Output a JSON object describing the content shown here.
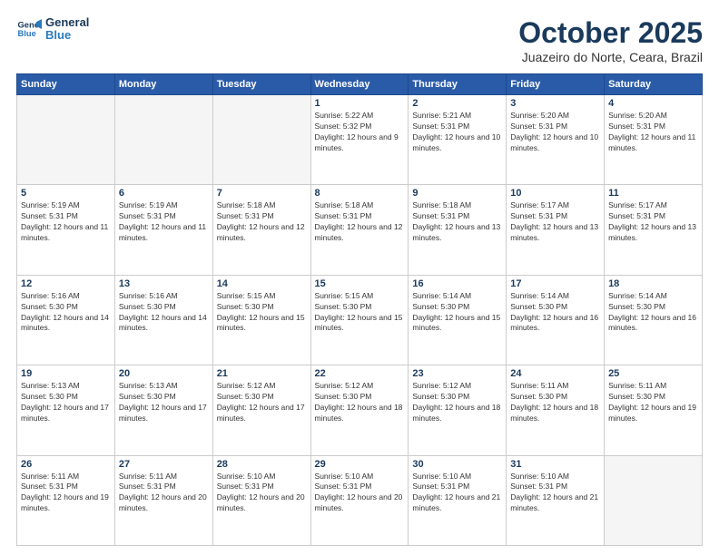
{
  "logo": {
    "line1": "General",
    "line2": "Blue"
  },
  "header": {
    "month": "October 2025",
    "location": "Juazeiro do Norte, Ceara, Brazil"
  },
  "days_of_week": [
    "Sunday",
    "Monday",
    "Tuesday",
    "Wednesday",
    "Thursday",
    "Friday",
    "Saturday"
  ],
  "weeks": [
    [
      {
        "day": "",
        "info": ""
      },
      {
        "day": "",
        "info": ""
      },
      {
        "day": "",
        "info": ""
      },
      {
        "day": "1",
        "info": "Sunrise: 5:22 AM\nSunset: 5:32 PM\nDaylight: 12 hours and 9 minutes."
      },
      {
        "day": "2",
        "info": "Sunrise: 5:21 AM\nSunset: 5:31 PM\nDaylight: 12 hours and 10 minutes."
      },
      {
        "day": "3",
        "info": "Sunrise: 5:20 AM\nSunset: 5:31 PM\nDaylight: 12 hours and 10 minutes."
      },
      {
        "day": "4",
        "info": "Sunrise: 5:20 AM\nSunset: 5:31 PM\nDaylight: 12 hours and 11 minutes."
      }
    ],
    [
      {
        "day": "5",
        "info": "Sunrise: 5:19 AM\nSunset: 5:31 PM\nDaylight: 12 hours and 11 minutes."
      },
      {
        "day": "6",
        "info": "Sunrise: 5:19 AM\nSunset: 5:31 PM\nDaylight: 12 hours and 11 minutes."
      },
      {
        "day": "7",
        "info": "Sunrise: 5:18 AM\nSunset: 5:31 PM\nDaylight: 12 hours and 12 minutes."
      },
      {
        "day": "8",
        "info": "Sunrise: 5:18 AM\nSunset: 5:31 PM\nDaylight: 12 hours and 12 minutes."
      },
      {
        "day": "9",
        "info": "Sunrise: 5:18 AM\nSunset: 5:31 PM\nDaylight: 12 hours and 13 minutes."
      },
      {
        "day": "10",
        "info": "Sunrise: 5:17 AM\nSunset: 5:31 PM\nDaylight: 12 hours and 13 minutes."
      },
      {
        "day": "11",
        "info": "Sunrise: 5:17 AM\nSunset: 5:31 PM\nDaylight: 12 hours and 13 minutes."
      }
    ],
    [
      {
        "day": "12",
        "info": "Sunrise: 5:16 AM\nSunset: 5:30 PM\nDaylight: 12 hours and 14 minutes."
      },
      {
        "day": "13",
        "info": "Sunrise: 5:16 AM\nSunset: 5:30 PM\nDaylight: 12 hours and 14 minutes."
      },
      {
        "day": "14",
        "info": "Sunrise: 5:15 AM\nSunset: 5:30 PM\nDaylight: 12 hours and 15 minutes."
      },
      {
        "day": "15",
        "info": "Sunrise: 5:15 AM\nSunset: 5:30 PM\nDaylight: 12 hours and 15 minutes."
      },
      {
        "day": "16",
        "info": "Sunrise: 5:14 AM\nSunset: 5:30 PM\nDaylight: 12 hours and 15 minutes."
      },
      {
        "day": "17",
        "info": "Sunrise: 5:14 AM\nSunset: 5:30 PM\nDaylight: 12 hours and 16 minutes."
      },
      {
        "day": "18",
        "info": "Sunrise: 5:14 AM\nSunset: 5:30 PM\nDaylight: 12 hours and 16 minutes."
      }
    ],
    [
      {
        "day": "19",
        "info": "Sunrise: 5:13 AM\nSunset: 5:30 PM\nDaylight: 12 hours and 17 minutes."
      },
      {
        "day": "20",
        "info": "Sunrise: 5:13 AM\nSunset: 5:30 PM\nDaylight: 12 hours and 17 minutes."
      },
      {
        "day": "21",
        "info": "Sunrise: 5:12 AM\nSunset: 5:30 PM\nDaylight: 12 hours and 17 minutes."
      },
      {
        "day": "22",
        "info": "Sunrise: 5:12 AM\nSunset: 5:30 PM\nDaylight: 12 hours and 18 minutes."
      },
      {
        "day": "23",
        "info": "Sunrise: 5:12 AM\nSunset: 5:30 PM\nDaylight: 12 hours and 18 minutes."
      },
      {
        "day": "24",
        "info": "Sunrise: 5:11 AM\nSunset: 5:30 PM\nDaylight: 12 hours and 18 minutes."
      },
      {
        "day": "25",
        "info": "Sunrise: 5:11 AM\nSunset: 5:30 PM\nDaylight: 12 hours and 19 minutes."
      }
    ],
    [
      {
        "day": "26",
        "info": "Sunrise: 5:11 AM\nSunset: 5:31 PM\nDaylight: 12 hours and 19 minutes."
      },
      {
        "day": "27",
        "info": "Sunrise: 5:11 AM\nSunset: 5:31 PM\nDaylight: 12 hours and 20 minutes."
      },
      {
        "day": "28",
        "info": "Sunrise: 5:10 AM\nSunset: 5:31 PM\nDaylight: 12 hours and 20 minutes."
      },
      {
        "day": "29",
        "info": "Sunrise: 5:10 AM\nSunset: 5:31 PM\nDaylight: 12 hours and 20 minutes."
      },
      {
        "day": "30",
        "info": "Sunrise: 5:10 AM\nSunset: 5:31 PM\nDaylight: 12 hours and 21 minutes."
      },
      {
        "day": "31",
        "info": "Sunrise: 5:10 AM\nSunset: 5:31 PM\nDaylight: 12 hours and 21 minutes."
      },
      {
        "day": "",
        "info": ""
      }
    ]
  ]
}
